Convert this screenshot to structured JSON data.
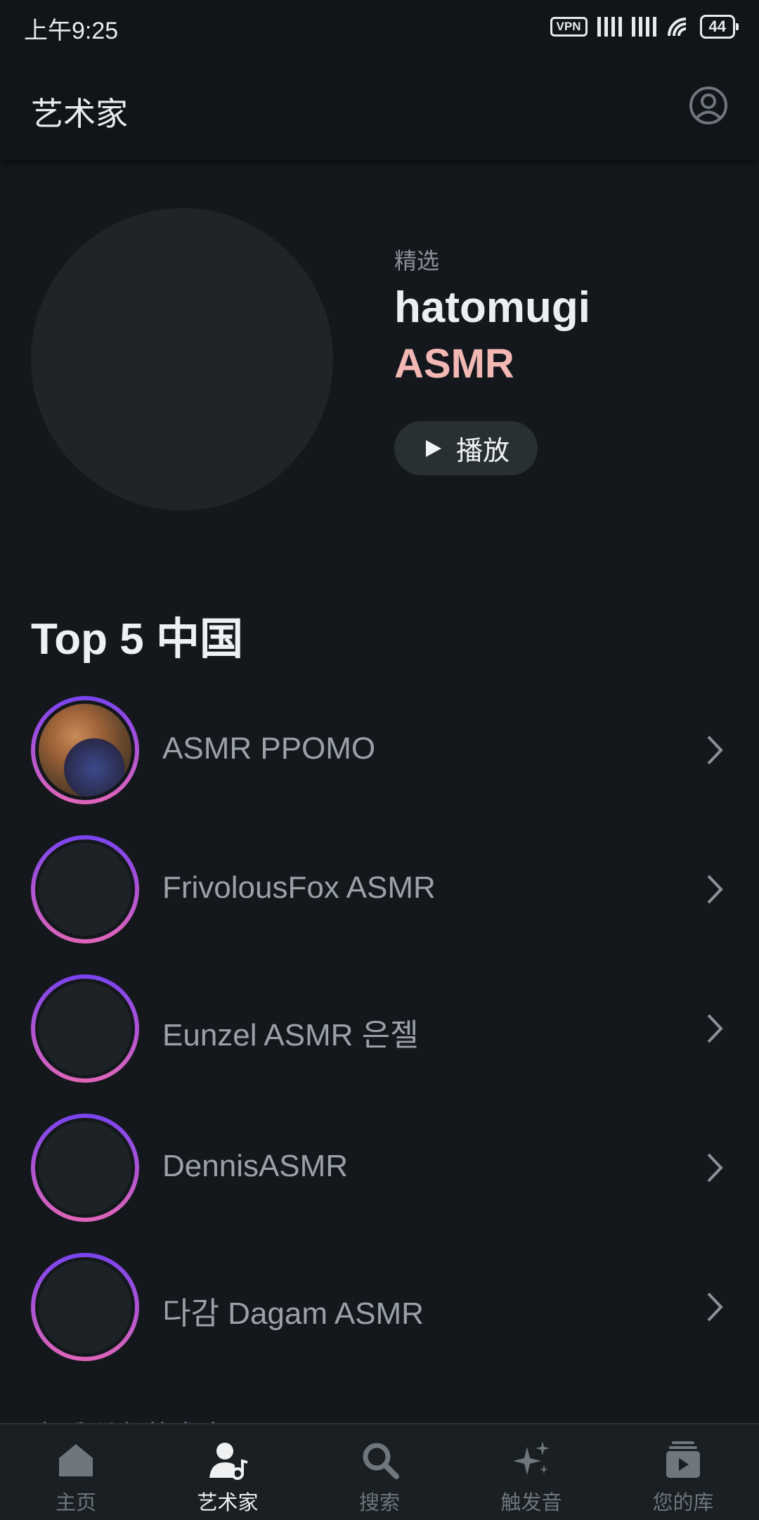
{
  "status": {
    "time": "上午9:25",
    "vpn": "VPN",
    "battery": "44"
  },
  "appbar": {
    "title": "艺术家"
  },
  "featured": {
    "tag": "精选",
    "name": "hatomugi",
    "subtitle": "ASMR",
    "play_label": "播放"
  },
  "section": {
    "title": "Top 5 中国",
    "items": [
      {
        "label": "ASMR PPOMO"
      },
      {
        "label": "FrivolousFox ASMR"
      },
      {
        "label": "Eunzel ASMR 은젤"
      },
      {
        "label": "DennisASMR"
      },
      {
        "label": "다감 Dagam ASMR"
      }
    ]
  },
  "peek_text": "查看所有艺术家",
  "nav": {
    "items": [
      {
        "label": "主页",
        "icon": "home-icon"
      },
      {
        "label": "艺术家",
        "icon": "artist-icon"
      },
      {
        "label": "搜索",
        "icon": "search-icon"
      },
      {
        "label": "触发音",
        "icon": "sparkle-icon"
      },
      {
        "label": "您的库",
        "icon": "library-icon"
      }
    ],
    "active_index": 1
  },
  "colors": {
    "accent_pink": "#f4b8b4",
    "ring_top": "#7a43f0",
    "ring_bottom": "#e065b8",
    "background": "#14181d"
  }
}
